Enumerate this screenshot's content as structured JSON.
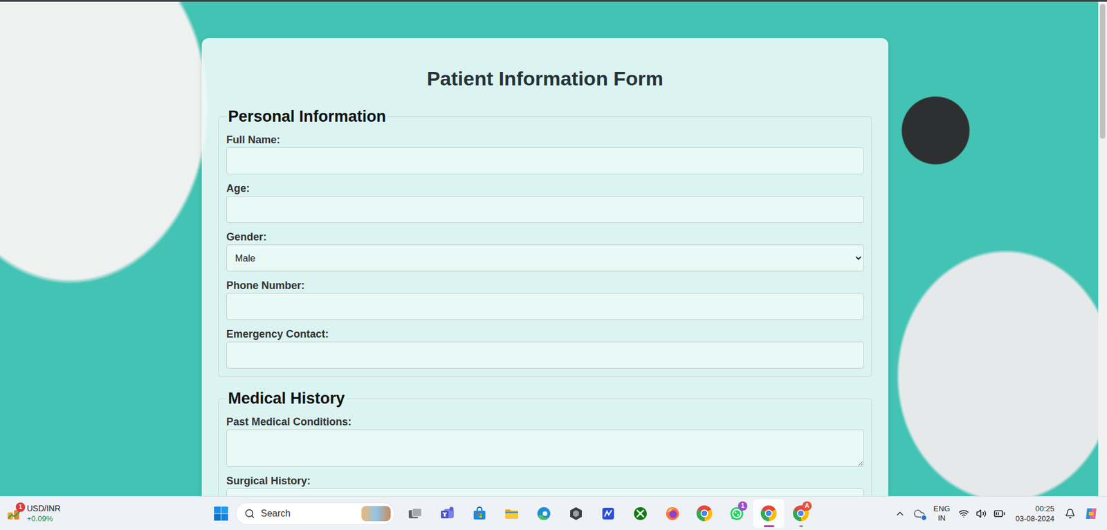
{
  "form": {
    "title": "Patient Information Form",
    "sections": [
      {
        "legend": "Personal Information",
        "fields": [
          {
            "label": "Full Name:",
            "kind": "text",
            "value": ""
          },
          {
            "label": "Age:",
            "kind": "text",
            "value": ""
          },
          {
            "label": "Gender:",
            "kind": "select",
            "value": "Male"
          },
          {
            "label": "Phone Number:",
            "kind": "text",
            "value": ""
          },
          {
            "label": "Emergency Contact:",
            "kind": "text",
            "value": ""
          }
        ]
      },
      {
        "legend": "Medical History",
        "fields": [
          {
            "label": "Past Medical Conditions:",
            "kind": "textarea",
            "value": ""
          },
          {
            "label": "Surgical History:",
            "kind": "textarea",
            "value": ""
          }
        ]
      }
    ]
  },
  "taskbar": {
    "widget": {
      "title": "USD/INR",
      "change": "+0.09%",
      "badge": "1"
    },
    "search": {
      "placeholder": "Search"
    },
    "apps": [
      {
        "kind": "task-view",
        "active": false,
        "open": false
      },
      {
        "kind": "teams",
        "active": false,
        "open": false
      },
      {
        "kind": "store",
        "active": false,
        "open": false
      },
      {
        "kind": "explorer",
        "active": false,
        "open": false
      },
      {
        "kind": "edge",
        "active": false,
        "open": false
      },
      {
        "kind": "hex-app",
        "active": false,
        "open": false
      },
      {
        "kind": "blue-app",
        "active": false,
        "open": false
      },
      {
        "kind": "xbox",
        "active": false,
        "open": false
      },
      {
        "kind": "firefox",
        "active": false,
        "open": false
      },
      {
        "kind": "chrome",
        "active": false,
        "open": false
      },
      {
        "kind": "whatsapp",
        "active": false,
        "open": false,
        "badge": "1",
        "color": "#9b4fc9"
      },
      {
        "kind": "chrome",
        "active": true,
        "open": true
      },
      {
        "kind": "chrome",
        "active": false,
        "open": true,
        "badge": "A",
        "color": "#e5533c"
      }
    ],
    "tray": {
      "language": "ENG",
      "region": "IN",
      "time": "00:25",
      "date": "03-08-2024"
    }
  }
}
